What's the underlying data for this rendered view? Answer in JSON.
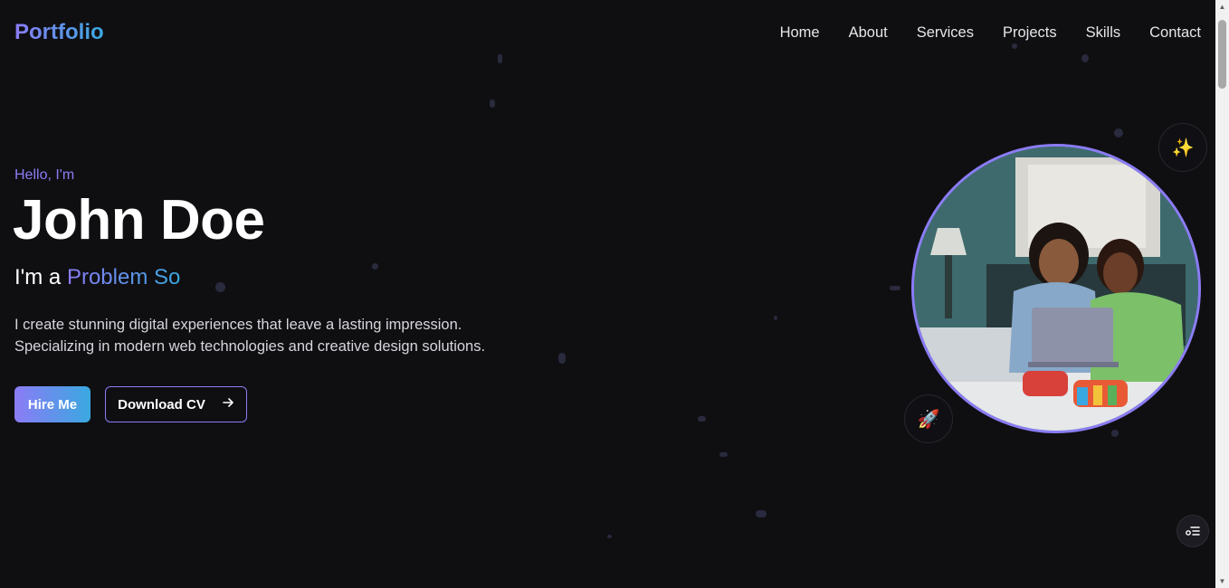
{
  "header": {
    "logo": "Portfolio",
    "nav": [
      "Home",
      "About",
      "Services",
      "Projects",
      "Skills",
      "Contact"
    ]
  },
  "hero": {
    "greeting": "Hello, I'm",
    "name": "John Doe",
    "role_prefix": "I'm a ",
    "role_typed": "Problem So",
    "description_line1": "I create stunning digital experiences that leave a lasting impression.",
    "description_line2": "Specializing in modern web technologies and creative design solutions.",
    "hire_label": "Hire Me",
    "cv_label": "Download CV"
  },
  "badges": {
    "sparkle": "✨",
    "rocket": "🚀"
  },
  "colors": {
    "background": "#0f0f12",
    "accent_purple": "#8b7cf6",
    "accent_blue": "#3aa8e0"
  },
  "icons": {
    "cv_button": "arrow-right-icon",
    "floating_button": "menu-list-icon"
  }
}
